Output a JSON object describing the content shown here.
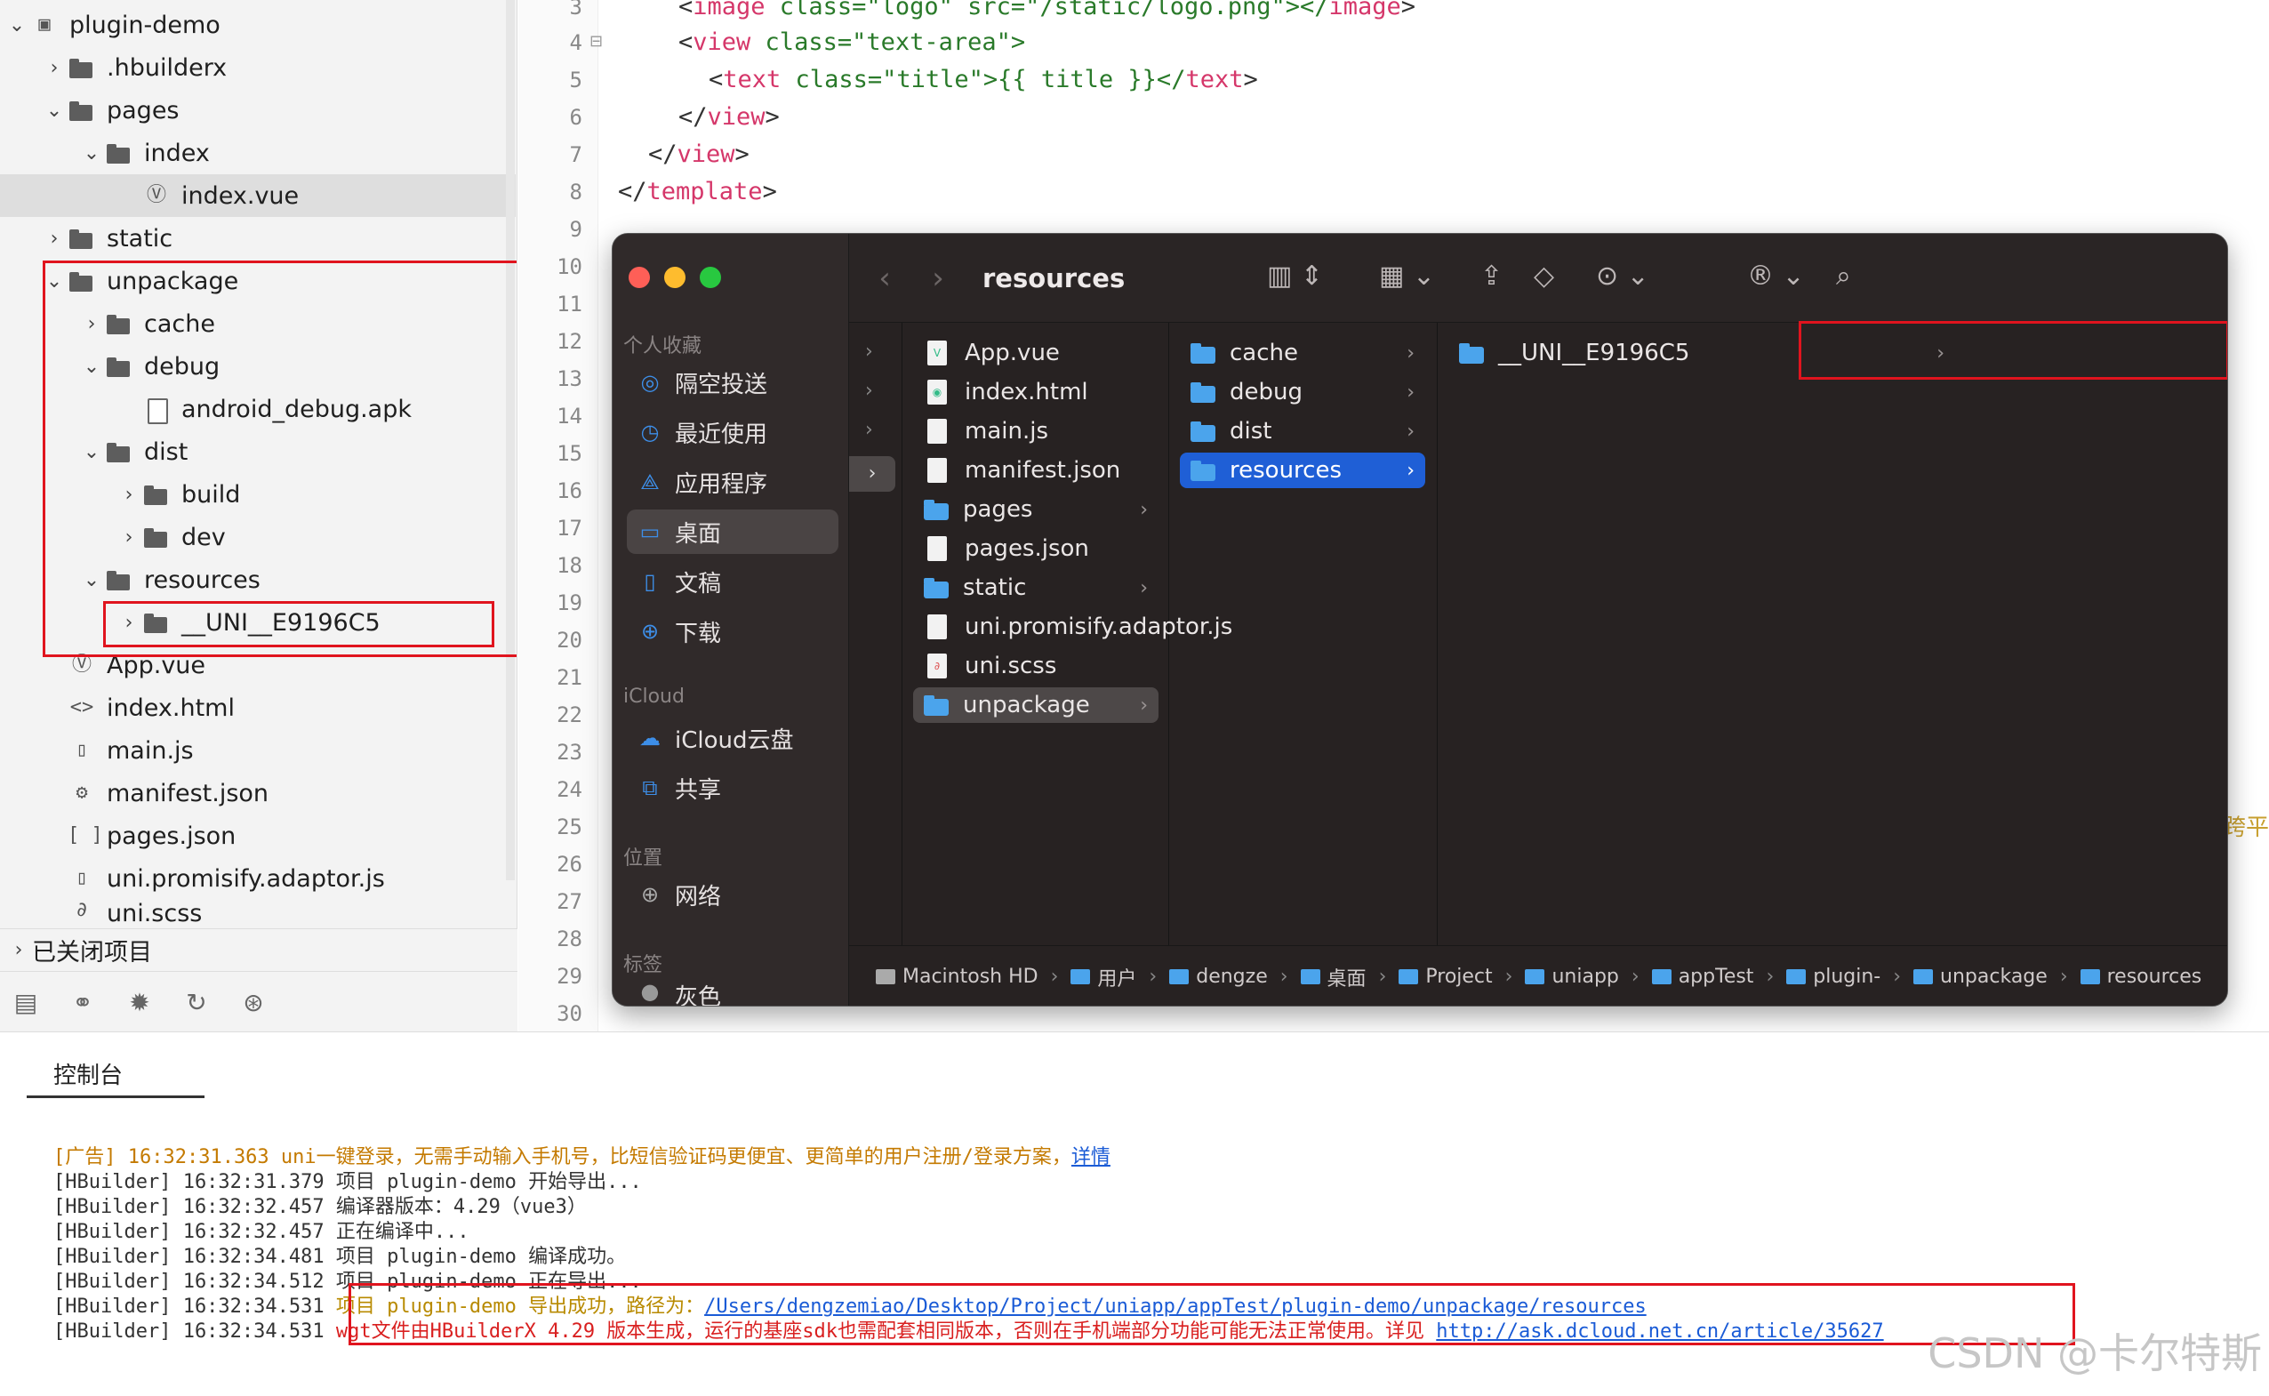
{
  "tree": {
    "items": [
      {
        "label": "plugin-demo"
      },
      {
        "label": ".hbuilderx"
      },
      {
        "label": "pages"
      },
      {
        "label": "index"
      },
      {
        "label": "index.vue"
      },
      {
        "label": "static"
      },
      {
        "label": "unpackage"
      },
      {
        "label": "cache"
      },
      {
        "label": "debug"
      },
      {
        "label": "android_debug.apk"
      },
      {
        "label": "dist"
      },
      {
        "label": "build"
      },
      {
        "label": "dev"
      },
      {
        "label": "resources"
      },
      {
        "label": "__UNI__E9196C5"
      },
      {
        "label": "App.vue"
      },
      {
        "label": "index.html"
      },
      {
        "label": "main.js"
      },
      {
        "label": "manifest.json"
      },
      {
        "label": "pages.json"
      },
      {
        "label": "uni.promisify.adaptor.js"
      },
      {
        "label": "uni.scss"
      }
    ],
    "closed_projects": "已关闭项目"
  },
  "editor": {
    "line_numbers": [
      "3",
      "4",
      "5",
      "6",
      "7",
      "8",
      "9",
      "10",
      "11",
      "12",
      "13",
      "14",
      "15",
      "16",
      "17",
      "18",
      "19",
      "20",
      "21",
      "22",
      "23",
      "24",
      "25",
      "26",
      "27",
      "28",
      "29",
      "30"
    ],
    "code": {
      "l3": {
        "open": "<",
        "tag": "image",
        "rest": " class=\"logo\" src=\"/static/logo.png\"></",
        "tag2": "image",
        "end": ">"
      },
      "l4": {
        "open": "<",
        "tag": "view",
        "rest": " class=\"text-area\">"
      },
      "l5": {
        "open": "<",
        "tag": "text",
        "rest": " class=\"title\">{{ title }}</",
        "tag2": "text",
        "end": ">"
      },
      "l6": {
        "open": "</",
        "tag": "view",
        "end": ">"
      },
      "l7": {
        "open": "</",
        "tag": "view",
        "end": ">"
      },
      "l8": {
        "open": "</",
        "tag": "template",
        "end": ">"
      }
    },
    "side_text": "跨平"
  },
  "finder": {
    "title": "resources",
    "sidebar": {
      "favorites_header": "个人收藏",
      "favorites": [
        "隔空投送",
        "最近使用",
        "应用程序",
        "桌面",
        "文稿",
        "下载"
      ],
      "icloud_header": "iCloud",
      "icloud": [
        "iCloud云盘",
        "共享"
      ],
      "locations_header": "位置",
      "locations": [
        "网络"
      ],
      "tags_header": "标签",
      "tags": [
        "灰色"
      ]
    },
    "col2": [
      "App.vue",
      "index.html",
      "main.js",
      "manifest.json",
      "pages",
      "pages.json",
      "static",
      "uni.promisify.adaptor.js",
      "uni.scss",
      "unpackage"
    ],
    "col3": [
      "cache",
      "debug",
      "dist",
      "resources"
    ],
    "col4": [
      "__UNI__E9196C5"
    ],
    "path": [
      "Macintosh HD",
      "用户",
      "dengze",
      "桌面",
      "Project",
      "uniapp",
      "appTest",
      "plugin-",
      "unpackage",
      "resources"
    ]
  },
  "console": {
    "tab": "控制台",
    "lines": {
      "l1a": "[广告] 16:32:31.363 uni一键登录，无需手动输入手机号，比短信验证码更便宜、更简单的用户注册/登录方案，",
      "l1link": "详情",
      "l2": "[HBuilder] 16:32:31.379 项目 plugin-demo 开始导出...",
      "l3": "[HBuilder] 16:32:32.457 编译器版本：4.29（vue3）",
      "l4": "[HBuilder] 16:32:32.457 正在编译中...",
      "l5": "[HBuilder] 16:32:34.481 项目 plugin-demo 编译成功。",
      "l6": "[HBuilder] 16:32:34.512 项目 plugin-demo 正在导出...",
      "l7prefix": "[HBuilder] 16:32:34.531 ",
      "l7msg": "项目 plugin-demo 导出成功，路径为：",
      "l7link": "/Users/dengzemiao/Desktop/Project/uniapp/appTest/plugin-demo/unpackage/resources",
      "l8prefix": "[HBuilder] 16:32:34.531 ",
      "l8msg": "wgt文件由HBuilderX 4.29 版本生成，运行的基座sdk也需配套相同版本，否则在手机端部分功能可能无法正常使用。详见 ",
      "l8link": "http://ask.dcloud.net.cn/article/35627"
    },
    "watermark": "CSDN @卡尔特斯"
  },
  "colors": {
    "highlight_box": "#e0141e",
    "finder_selection": "#1f5fd6",
    "folder_blue": "#4ba4ec"
  }
}
